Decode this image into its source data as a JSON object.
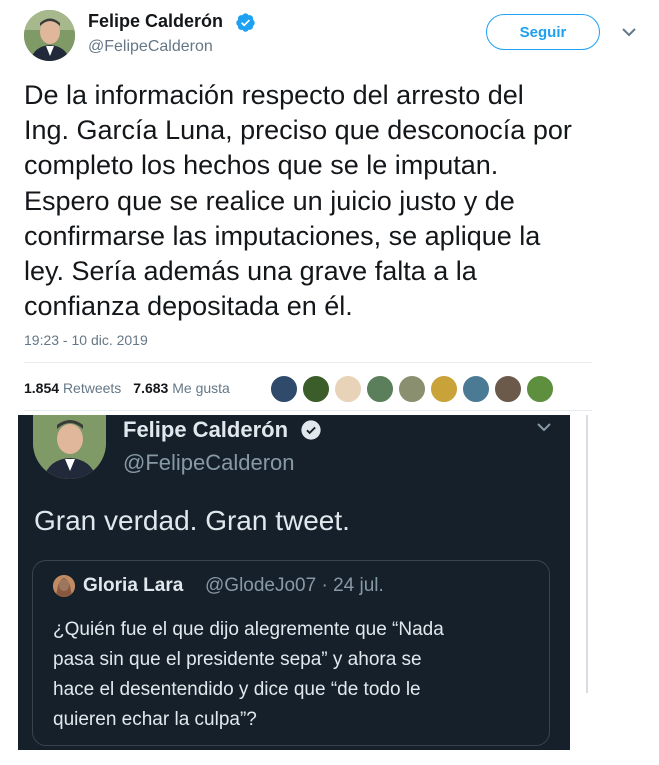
{
  "tweet": {
    "author_name": "Felipe Calderón",
    "author_handle": "@FelipeCalderon",
    "follow_label": "Seguir",
    "text": "De la información respecto del arresto del\nIng. García Luna, preciso que desconocía por\ncompleto los hechos que se le imputan.\nEspero que se realice un juicio justo y de\nconfirmarse las imputaciones, se aplique la\nley. Sería además una grave falta a la\nconfianza depositada en él.",
    "timestamp": "19:23 - 10 dic. 2019",
    "retweets_count": "1.854",
    "retweets_label": "Retweets",
    "likes_count": "7.683",
    "likes_label": "Me gusta",
    "liker_avatar_colors": [
      "#2f4a6a",
      "#3b5d2a",
      "#e8d2b8",
      "#5a7f5a",
      "#8a8f70",
      "#c9a23a",
      "#4b7a95",
      "#6b5a4a",
      "#5d8f3f"
    ]
  },
  "embedded_screenshot": {
    "author_name": "Felipe Calderón",
    "author_handle": "@FelipeCalderon",
    "text": "Gran verdad. Gran tweet.",
    "quoted": {
      "author_name": "Gloria Lara",
      "author_handle_date": "@GlodeJo07 · 24 jul.",
      "text": "¿Quién fue el que dijo alegremente que “Nada\npasa sin que el presidente sepa” y ahora se\nhace el desentendido y dice que “de todo le\nquieren echar la culpa”?"
    }
  },
  "icons": {
    "verified": "verified-badge-icon",
    "caret": "chevron-down-icon"
  },
  "colors": {
    "accent": "#1da1f2",
    "dark_bg": "#15202b",
    "muted": "#657786"
  }
}
